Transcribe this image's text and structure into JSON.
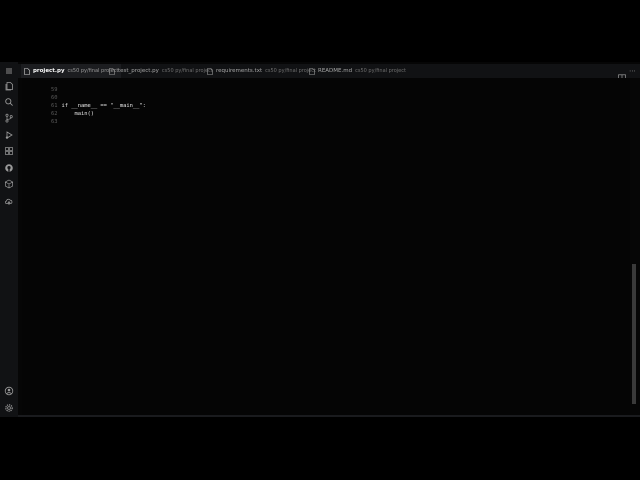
{
  "tabs": [
    {
      "name": "project.py",
      "path": "cs50 py/final project",
      "active": true
    },
    {
      "name": "test_project.py",
      "path": "cs50 py/final project",
      "active": false
    },
    {
      "name": "requirements.txt",
      "path": "cs50 py/final project",
      "active": false
    },
    {
      "name": "README.md",
      "path": "cs50 py/final project",
      "active": false
    }
  ],
  "editor": {
    "lines": [
      {
        "num": "59",
        "code": ""
      },
      {
        "num": "60",
        "code": ""
      },
      {
        "num": "61",
        "code": "if __name__ == \"__main__\":"
      },
      {
        "num": "62",
        "code": "    main()"
      },
      {
        "num": "63",
        "code": ""
      }
    ]
  },
  "activity_icons": [
    "menu-icon",
    "files-icon",
    "search-icon",
    "source-control-icon",
    "run-debug-icon",
    "extensions-icon",
    "github-icon",
    "remote-explorer-icon",
    "deploy-icon",
    "account-icon",
    "settings-gear-icon"
  ],
  "colors": {
    "background": "#000000",
    "activity_bar": "#111214",
    "active_tab": "#1c1d20",
    "text": "#e8e8e8",
    "line_numbers": "#5a5a5a"
  }
}
